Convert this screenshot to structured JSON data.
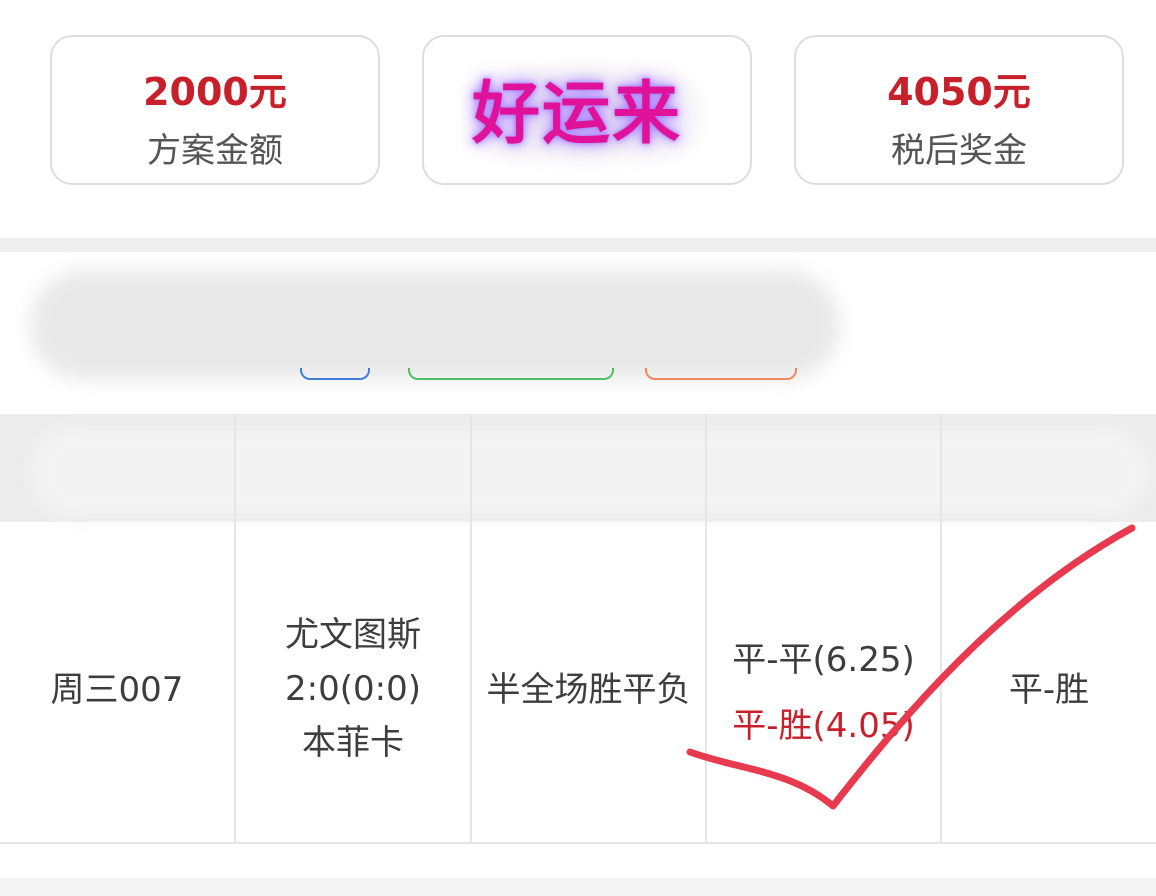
{
  "summary": {
    "plan_amount": {
      "value": "2000元",
      "label": "方案金额"
    },
    "after_tax_prize": {
      "value": "4050元",
      "label": "税后奖金"
    }
  },
  "sticker": {
    "text": "好运来"
  },
  "table": {
    "rows": [
      {
        "match_no": "周三007",
        "match": {
          "home": "尤文图斯",
          "score": "2:0(0:0)",
          "away": "本菲卡"
        },
        "play_type": "半全场胜平负",
        "options": [
          {
            "text": "平-平(6.25)",
            "status": "normal"
          },
          {
            "text": "平-胜(4.05)",
            "status": "hit"
          }
        ],
        "result": "平-胜"
      }
    ]
  },
  "colors": {
    "accent_red": "#c8202a",
    "sticker_magenta": "#e1129a",
    "sticker_glow": "#a479ff",
    "check_mark": "#e83a4f"
  }
}
